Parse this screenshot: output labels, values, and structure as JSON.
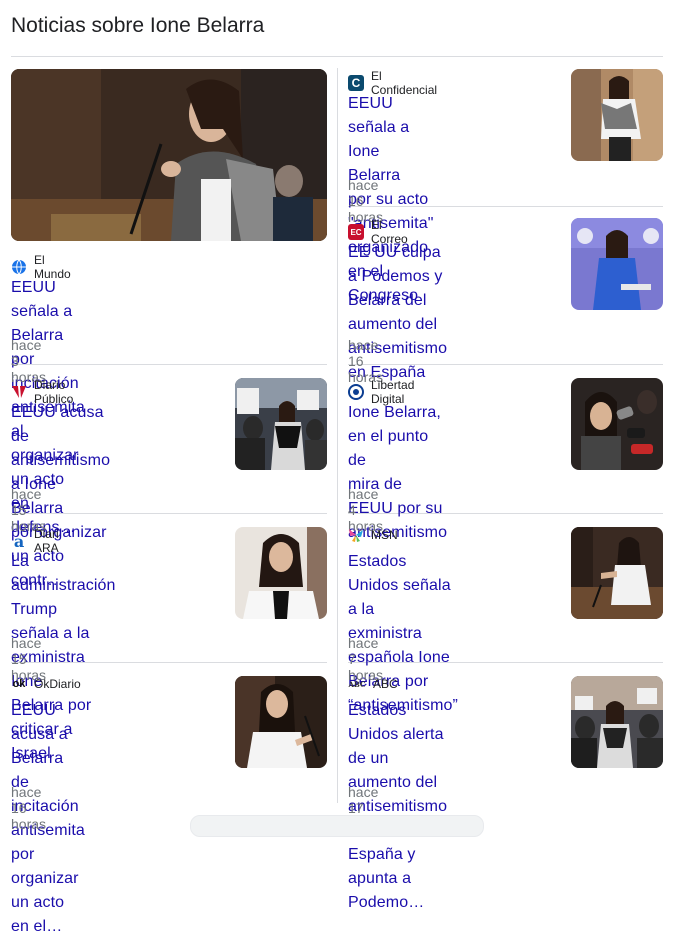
{
  "heading": "Noticias sobre Ione Belarra",
  "articles": [
    {
      "source": "El Mundo",
      "title_lines": [
        "EEUU señala a Belarra por incitación",
        "antisemita al organizar un acto en defens…"
      ],
      "time": "hace 3 horas",
      "logo_icon": "globe-icon",
      "logo_color": "#1a73e8"
    },
    {
      "source": "El Confidencial",
      "title_lines": [
        "EEUU señala a Ione Belarra",
        "por su acto \"antisemita\"",
        "organizado en el Congreso"
      ],
      "time": "hace 16 horas",
      "logo_text": "C",
      "logo_color": "#0b4a6e"
    },
    {
      "source": "El Correo",
      "title_lines": [
        "EE UU culpa a Podemos y",
        "Belarra del aumento del",
        "antisemitismo en España"
      ],
      "time": "hace 16 horas",
      "logo_text": "EC",
      "logo_color": "#c8102e"
    },
    {
      "source": "Diario Público",
      "title_lines": [
        "EEUU acusa de",
        "antisemitismo a Ione Belarra",
        "por organizar un acto contr…"
      ],
      "time": "hace 15 horas",
      "logo_text": "P",
      "logo_color": "#c8102e"
    },
    {
      "source": "Libertad Digital",
      "title_lines": [
        "Ione Belarra, en el punto de",
        "mira de EEUU por su",
        "antisemitismo"
      ],
      "time": "hace 4 horas",
      "logo_text": "D",
      "logo_color": "#0b3d91"
    },
    {
      "source": "Diari ARA",
      "title_lines": [
        "La administración Trump",
        "señala a la exministra Ione",
        "Belarra por criticar a Israel"
      ],
      "time": "hace 15 horas",
      "logo_text": "a",
      "logo_color": "#1565c0"
    },
    {
      "source": "MSN",
      "title_lines": [
        "Estados Unidos señala a la",
        "exministra española Ione",
        "Belarra por “antisemitismo”"
      ],
      "time": "hace 7 horas",
      "logo_icon": "butterfly-icon",
      "logo_color": "#e84c9a"
    },
    {
      "source": "OkDiario",
      "title_lines": [
        "EEUU acusa a Belarra de",
        "incitación antisemita por",
        "organizar un acto en el…"
      ],
      "time": "hace 16 horas",
      "logo_text": "ok",
      "logo_color": "#111111"
    },
    {
      "source": "ABC",
      "title_lines": [
        "Estados Unidos alerta de un",
        "aumento del antisemitismo en",
        "España y apunta a Podemo…"
      ],
      "time": "hace 17 horas",
      "logo_text": "ABC",
      "logo_color": "#333333"
    }
  ],
  "colors": {
    "link": "#1a0dab",
    "meta": "#70757a",
    "divider": "#dadce0"
  }
}
